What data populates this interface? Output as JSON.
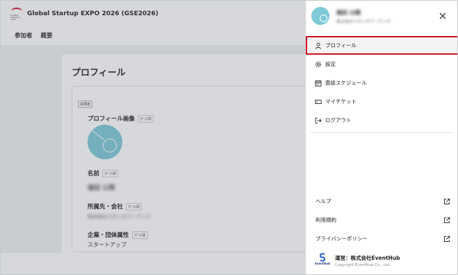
{
  "header": {
    "event_title": "Global Startup EXPO 2026 (GSE2026)",
    "logo_text": "GLOBAL STARTUP EXPO"
  },
  "nav": {
    "participants": "参加者",
    "overview": "概要"
  },
  "profile": {
    "page_title": "プロフィール",
    "tag": "来場者",
    "image_label": "プロフィール画像",
    "name_label": "名前",
    "affiliation_label": "所属先・会社",
    "attribute_label": "企業・団体属性",
    "attribute_value": "スタートアップ",
    "public_badge": "公開",
    "name_value": "堀田 公翔",
    "company_value": "株式会社スタンダブーデング"
  },
  "drawer": {
    "user_name": "堀田 公翔",
    "user_company": "株式会社スタンダブーデング",
    "close_icon": "close-icon",
    "menu": [
      {
        "label": "プロフィール",
        "icon": "user-icon",
        "active": true
      },
      {
        "label": "設定",
        "icon": "gear-icon",
        "active": false
      },
      {
        "label": "面談スケジュール",
        "icon": "calendar-icon",
        "active": false
      },
      {
        "label": "マイチケット",
        "icon": "ticket-icon",
        "active": false
      },
      {
        "label": "ログアウト",
        "icon": "logout-icon",
        "active": false
      }
    ],
    "links": [
      {
        "label": "ヘルプ",
        "icon": "external-link-icon"
      },
      {
        "label": "利用規約",
        "icon": "external-link-icon"
      },
      {
        "label": "プライバシーポリシー",
        "icon": "external-link-icon"
      }
    ],
    "footer": {
      "operator": "運営：株式会社EventHub",
      "copyright": "Copyright EventHub Co., Ltd.",
      "logo_caption": "EventHub"
    }
  },
  "colors": {
    "highlight": "#d0111d",
    "avatar": "#7fc9d8",
    "overlay": "rgba(90,100,110,0.25)"
  }
}
